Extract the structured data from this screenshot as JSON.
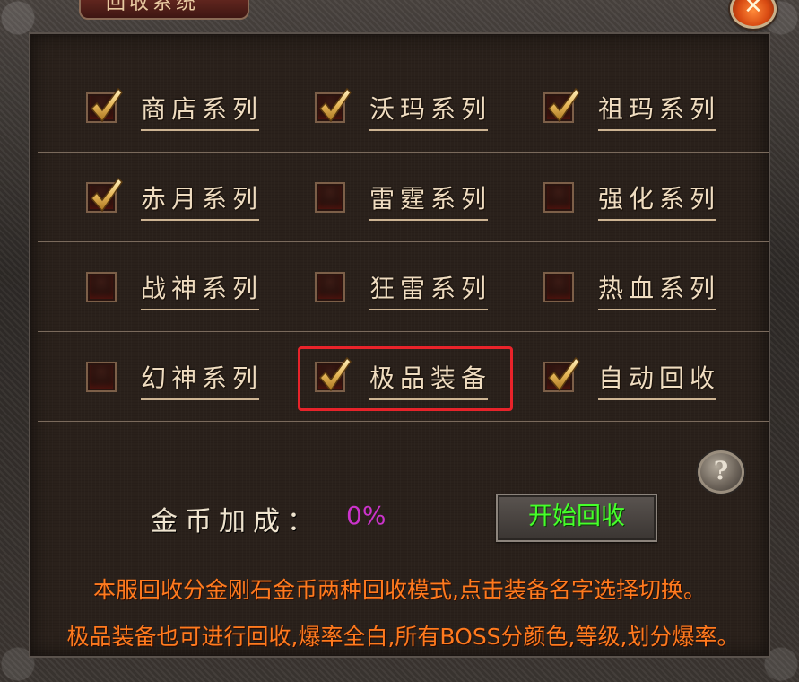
{
  "window": {
    "title": "回收系统",
    "close_symbol": "✕"
  },
  "categories": [
    [
      {
        "label": "商店系列",
        "checked": true
      },
      {
        "label": "沃玛系列",
        "checked": true
      },
      {
        "label": "祖玛系列",
        "checked": true
      }
    ],
    [
      {
        "label": "赤月系列",
        "checked": true
      },
      {
        "label": "雷霆系列",
        "checked": false
      },
      {
        "label": "强化系列",
        "checked": false
      }
    ],
    [
      {
        "label": "战神系列",
        "checked": false
      },
      {
        "label": "狂雷系列",
        "checked": false
      },
      {
        "label": "热血系列",
        "checked": false
      }
    ],
    [
      {
        "label": "幻神系列",
        "checked": false
      },
      {
        "label": "极品装备",
        "checked": true
      },
      {
        "label": "自动回收",
        "checked": true
      }
    ]
  ],
  "help": {
    "symbol": "?"
  },
  "bonus": {
    "label": "金币加成：",
    "value": "0%"
  },
  "start_button": {
    "label": "开始回收"
  },
  "notes": [
    "本服回收分金刚石金币两种回收模式,点击装备名字选择切换。",
    "极品装备也可进行回收,爆率全白,所有BOSS分颜色,等级,划分爆率。"
  ],
  "colors": {
    "note": "#ff7a1e",
    "bonus_value": "#cc33cc",
    "start_label": "#46ff2a",
    "highlight": "#e8232a"
  }
}
